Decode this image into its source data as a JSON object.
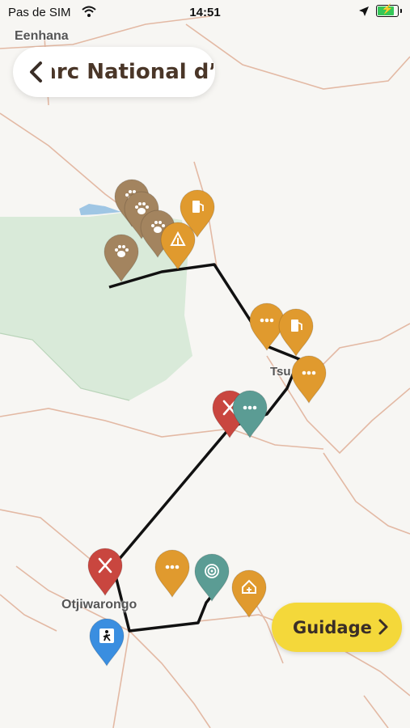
{
  "status_bar": {
    "carrier": "Pas de SIM",
    "time": "14:51",
    "battery_level": 0.9
  },
  "header": {
    "title": "Parc National d’Etosha",
    "back_icon": "chevron-left-icon"
  },
  "map": {
    "places": {
      "top_left": "Eenhana",
      "middle": "Tsu",
      "bottom_left": "Otjiwarongo"
    },
    "colors": {
      "route": "#111111",
      "park": "#d9ead9",
      "water": "#9fc6e4",
      "road": "#e3b9a4",
      "poi_orange": "#e09a2e",
      "poi_brown": "#a3845f",
      "poi_red": "#c9463f",
      "poi_teal": "#5b9c94",
      "poi_dark": "#3e3431",
      "poi_blue": "#3a8ee0"
    },
    "markers": [
      {
        "icon": "paw-icon",
        "color": "poi_brown"
      },
      {
        "icon": "paw-icon",
        "color": "poi_brown"
      },
      {
        "icon": "paw-icon",
        "color": "poi_brown"
      },
      {
        "icon": "paw-icon",
        "color": "poi_brown"
      },
      {
        "icon": "fuel-icon",
        "color": "poi_orange"
      },
      {
        "icon": "tent-icon",
        "color": "poi_orange"
      },
      {
        "icon": "more-icon",
        "color": "poi_orange"
      },
      {
        "icon": "fuel-icon",
        "color": "poi_orange"
      },
      {
        "icon": "more-icon",
        "color": "poi_orange"
      },
      {
        "icon": "restaurant-icon",
        "color": "poi_red"
      },
      {
        "icon": "more-icon",
        "color": "poi_teal"
      },
      {
        "icon": "restaurant-icon",
        "color": "poi_red"
      },
      {
        "icon": "more-icon",
        "color": "poi_orange"
      },
      {
        "icon": "spiral-icon",
        "color": "poi_teal"
      },
      {
        "icon": "lodge-icon",
        "color": "poi_orange"
      },
      {
        "icon": "hiker-icon",
        "color": "poi_blue"
      }
    ]
  },
  "guide_button": {
    "label": "Guidage"
  }
}
